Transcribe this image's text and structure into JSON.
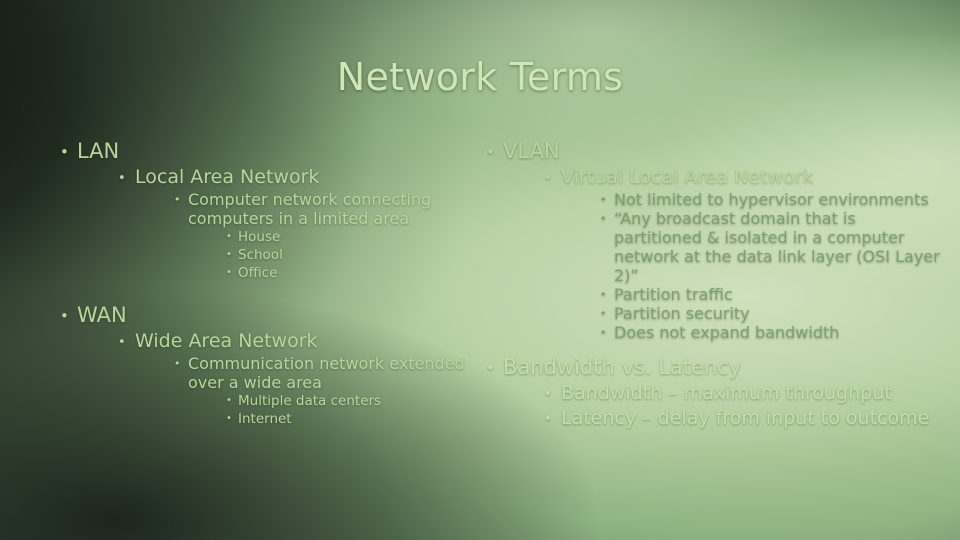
{
  "slide": {
    "title": "Network Terms",
    "bullet_glyph": "•",
    "colors": {
      "title": "#cfe7b5",
      "dark_text": "#1c2a1b",
      "light_text": "#b8d69c"
    },
    "left_column": [
      {
        "label": "LAN",
        "children": [
          {
            "label": "Local Area Network",
            "children": [
              {
                "label": "Computer network connecting computers in a limited area",
                "children": [
                  {
                    "label": "House"
                  },
                  {
                    "label": "School"
                  },
                  {
                    "label": "Office"
                  }
                ]
              }
            ]
          }
        ]
      },
      {
        "label": "WAN",
        "children": [
          {
            "label": "Wide Area Network",
            "children": [
              {
                "label": "Communication network extended over a wide area",
                "children": [
                  {
                    "label": "Multiple data centers"
                  },
                  {
                    "label": "Internet"
                  }
                ]
              }
            ]
          }
        ]
      }
    ],
    "right_column": [
      {
        "label": "VLAN",
        "children": [
          {
            "label": "Virtual Local Area Network",
            "children": [
              {
                "label": "Not limited to hypervisor environments"
              },
              {
                "label": "“Any broadcast domain that is partitioned & isolated in a computer network at the data link layer (OSI Layer 2)”"
              },
              {
                "label": "Partition traffic"
              },
              {
                "label": "Partition security"
              },
              {
                "label": "Does not expand bandwidth"
              }
            ]
          }
        ]
      },
      {
        "label": "Bandwidth vs. Latency",
        "children": [
          {
            "label": "Bandwidth – maximum throughput"
          },
          {
            "label": "Latency – delay from input to outcome"
          }
        ]
      }
    ]
  }
}
